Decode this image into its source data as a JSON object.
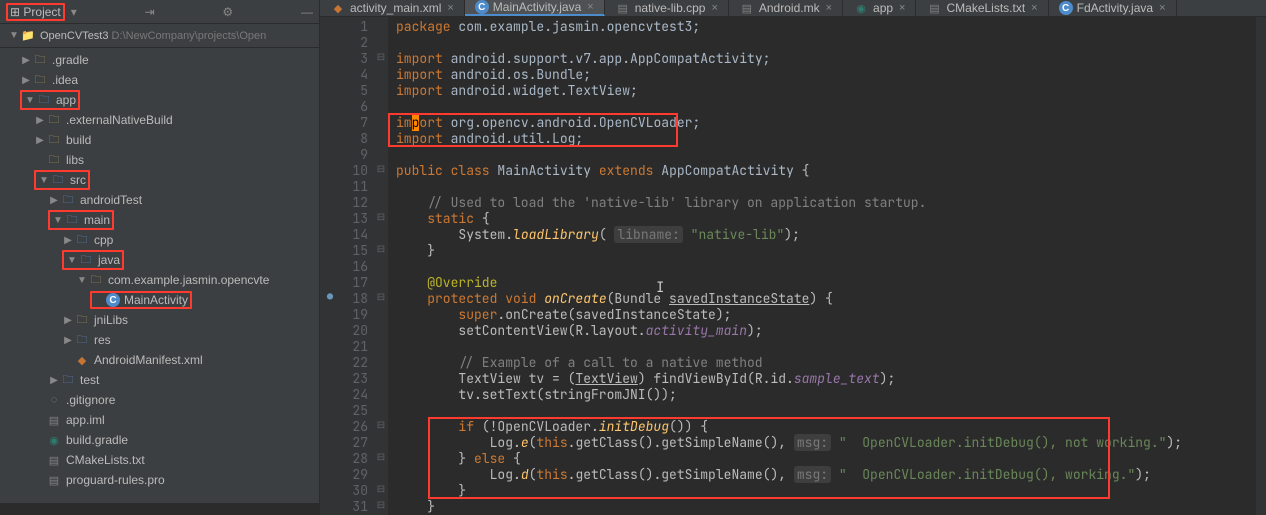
{
  "sidebar": {
    "header": "Project",
    "gear": "⚙",
    "breadcrumb_name": "OpenCVTest3",
    "breadcrumb_path": "D:\\NewCompany\\projects\\Open",
    "items": [
      {
        "indent": 1,
        "arrow": "▶",
        "icon": "folder",
        "label": ".gradle"
      },
      {
        "indent": 1,
        "arrow": "▶",
        "icon": "folder",
        "label": ".idea"
      },
      {
        "indent": 1,
        "arrow": "▼",
        "icon": "module",
        "label": "app",
        "hl": true
      },
      {
        "indent": 2,
        "arrow": "▶",
        "icon": "folder",
        "label": ".externalNativeBuild"
      },
      {
        "indent": 2,
        "arrow": "▶",
        "icon": "folder",
        "label": "build"
      },
      {
        "indent": 2,
        "arrow": "",
        "icon": "folder",
        "label": "libs"
      },
      {
        "indent": 2,
        "arrow": "▼",
        "icon": "folder-blue",
        "label": "src",
        "hl": true
      },
      {
        "indent": 3,
        "arrow": "▶",
        "icon": "folder-blue",
        "label": "androidTest"
      },
      {
        "indent": 3,
        "arrow": "▼",
        "icon": "folder-blue",
        "label": "main",
        "hl": true
      },
      {
        "indent": 4,
        "arrow": "▶",
        "icon": "folder-blue",
        "label": "cpp"
      },
      {
        "indent": 4,
        "arrow": "▼",
        "icon": "folder-blue",
        "label": "java",
        "hl": true
      },
      {
        "indent": 5,
        "arrow": "▼",
        "icon": "folder",
        "label": "com.example.jasmin.opencvte"
      },
      {
        "indent": 6,
        "arrow": "",
        "icon": "java",
        "label": "MainActivity",
        "hl": true
      },
      {
        "indent": 4,
        "arrow": "▶",
        "icon": "folder",
        "label": "jniLibs"
      },
      {
        "indent": 4,
        "arrow": "▶",
        "icon": "folder-blue",
        "label": "res"
      },
      {
        "indent": 4,
        "arrow": "",
        "icon": "xml",
        "label": "AndroidManifest.xml"
      },
      {
        "indent": 3,
        "arrow": "▶",
        "icon": "folder-blue",
        "label": "test"
      },
      {
        "indent": 2,
        "arrow": "",
        "icon": "git",
        "label": ".gitignore"
      },
      {
        "indent": 2,
        "arrow": "",
        "icon": "file",
        "label": "app.iml"
      },
      {
        "indent": 2,
        "arrow": "",
        "icon": "gradle",
        "label": "build.gradle"
      },
      {
        "indent": 2,
        "arrow": "",
        "icon": "file",
        "label": "CMakeLists.txt"
      },
      {
        "indent": 2,
        "arrow": "",
        "icon": "file",
        "label": "proguard-rules.pro"
      }
    ]
  },
  "tabs": [
    {
      "icon": "xml",
      "label": "activity_main.xml",
      "active": false
    },
    {
      "icon": "java",
      "label": "MainActivity.java",
      "active": true
    },
    {
      "icon": "file",
      "label": "native-lib.cpp",
      "active": false
    },
    {
      "icon": "file",
      "label": "Android.mk",
      "active": false
    },
    {
      "icon": "gradle",
      "label": "app",
      "active": false
    },
    {
      "icon": "file",
      "label": "CMakeLists.txt",
      "active": false
    },
    {
      "icon": "java",
      "label": "FdActivity.java",
      "active": false
    }
  ],
  "code": {
    "start_line": 1,
    "lines": [
      {
        "n": 1,
        "html": "<span class='kw'>package</span> <span class='pkg'>com.example.jasmin.opencvtest3;</span>"
      },
      {
        "n": 2,
        "html": ""
      },
      {
        "n": 3,
        "fold": "⊟",
        "html": "<span class='kw'>import</span> <span class='pkg'>android.support.v7.app.AppCompatActivity;</span>"
      },
      {
        "n": 4,
        "html": "<span class='kw'>import</span> <span class='pkg'>android.os.Bundle;</span>"
      },
      {
        "n": 5,
        "html": "<span class='kw'>import</span> <span class='pkg'>android.widget.TextView;</span>"
      },
      {
        "n": 6,
        "html": ""
      },
      {
        "n": 7,
        "html": "<span class='kw'>im<span style='background:#ff8800;color:#000'>p</span>ort</span> <span class='pkg'>org.opencv.android.OpenCVLoader;</span>"
      },
      {
        "n": 8,
        "html": "<span class='kw'>import</span> <span class='pkg'>android.util.Log;</span>"
      },
      {
        "n": 9,
        "html": ""
      },
      {
        "n": 10,
        "fold": "⊟",
        "html": "<span class='kw'>public class</span> <span class='type'>MainActivity</span> <span class='kw'>extends</span> <span class='type'>AppCompatActivity</span> {"
      },
      {
        "n": 11,
        "html": ""
      },
      {
        "n": 12,
        "html": "    <span class='com'>// Used to load the 'native-lib' library on application startup.</span>"
      },
      {
        "n": 13,
        "fold": "⊟",
        "html": "    <span class='kw'>static</span> {"
      },
      {
        "n": 14,
        "html": "        System.<span class='static-method'>loadLibrary</span>( <span class='param-hint'>libname:</span> <span class='str'>\"native-lib\"</span>);"
      },
      {
        "n": 15,
        "fold": "⊟",
        "html": "    }"
      },
      {
        "n": 16,
        "html": ""
      },
      {
        "n": 17,
        "html": "    <span class='ann'>@Override</span>"
      },
      {
        "n": 18,
        "fold": "⊟",
        "gi": "o↓",
        "html": "    <span class='kw'>protected void</span> <span class='static-method'>onCreate</span>(Bundle <span class='underline'>savedInstanceState</span>) {"
      },
      {
        "n": 19,
        "html": "        <span class='kw'>super</span>.onCreate(savedInstanceState);"
      },
      {
        "n": 20,
        "html": "        setContentView(R.layout.<span class='field'>activity_main</span>);"
      },
      {
        "n": 21,
        "html": ""
      },
      {
        "n": 22,
        "html": "        <span class='com'>// Example of a call to a native method</span>"
      },
      {
        "n": 23,
        "html": "        TextView tv = (<span class='underline'>TextView</span>) findViewById(R.id.<span class='field'>sample_text</span>);"
      },
      {
        "n": 24,
        "html": "        tv.setText(stringFromJNI());"
      },
      {
        "n": 25,
        "html": ""
      },
      {
        "n": 26,
        "fold": "⊟",
        "html": "        <span class='kw'>if</span> (!OpenCVLoader.<span class='static-method'>initDebug</span>()) {"
      },
      {
        "n": 27,
        "html": "            Log.<span class='static-method'>e</span>(<span class='kw'>this</span>.getClass().getSimpleName(), <span class='param-hint'>msg:</span> <span class='str'>\"  OpenCVLoader.initDebug(), not working.\"</span>);"
      },
      {
        "n": 28,
        "fold": "⊟",
        "html": "        } <span class='kw'>else</span> {"
      },
      {
        "n": 29,
        "html": "            Log.<span class='static-method'>d</span>(<span class='kw'>this</span>.getClass().getSimpleName(), <span class='param-hint'>msg:</span> <span class='str'>\"  OpenCVLoader.initDebug(), working.\"</span>);"
      },
      {
        "n": 30,
        "fold": "⊟",
        "html": "        }"
      },
      {
        "n": 31,
        "fold": "⊟",
        "html": "    }"
      }
    ]
  }
}
